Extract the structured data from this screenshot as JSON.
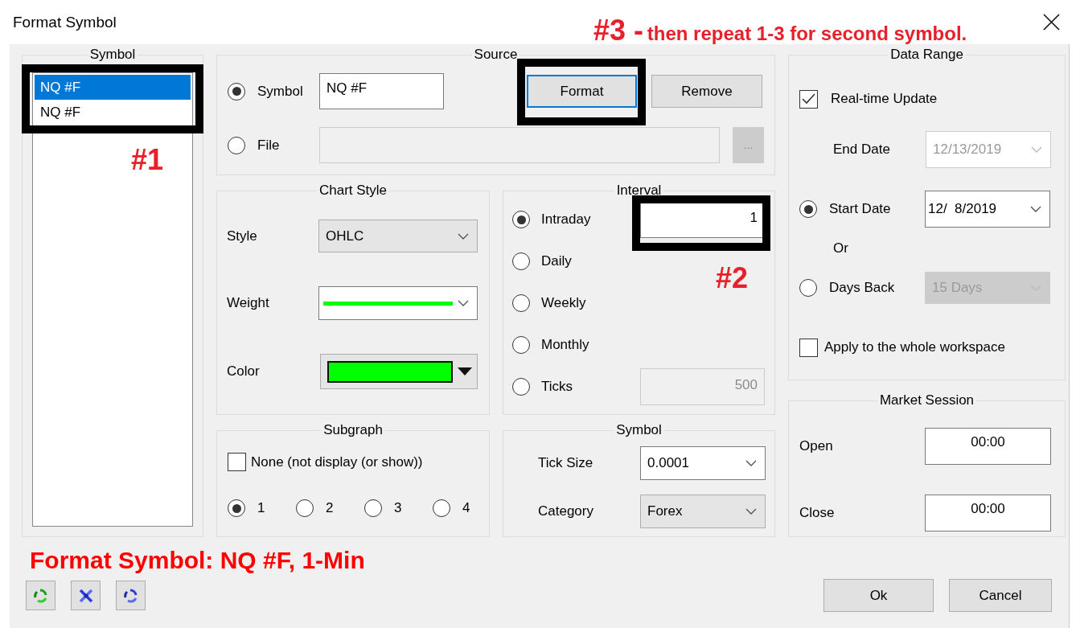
{
  "window": {
    "title": "Format Symbol"
  },
  "annotations": [
    {
      "text": "#3 -",
      "note": "then repeat 1-3 for second symbol."
    },
    {
      "text": "#1"
    },
    {
      "text": "#2"
    }
  ],
  "symbol_list": {
    "legend": "Symbol",
    "items": [
      {
        "label": "NQ #F",
        "selected": true
      },
      {
        "label": "NQ #F",
        "selected": false
      }
    ]
  },
  "source": {
    "legend": "Source",
    "options": [
      {
        "label": "Symbol",
        "selected": true,
        "value": "NQ #F",
        "disabled": false
      },
      {
        "label": "File",
        "selected": false,
        "disabled": true
      }
    ],
    "browse": "...",
    "buttons": [
      {
        "label": "Format",
        "focused": true
      },
      {
        "label": "Remove",
        "focused": false
      }
    ]
  },
  "chart_style": {
    "legend": "Chart Style",
    "style": {
      "label": "Style",
      "value": "OHLC"
    },
    "weight": {
      "label": "Weight",
      "color": "#00ff00"
    },
    "color": {
      "label": "Color",
      "color": "#00ff00"
    }
  },
  "interval": {
    "legend": "Interval",
    "options": [
      {
        "label": "Intraday",
        "selected": true,
        "value": "1",
        "disabled": false
      },
      {
        "label": "Daily",
        "selected": false
      },
      {
        "label": "Weekly",
        "selected": false
      },
      {
        "label": "Monthly",
        "selected": false
      },
      {
        "label": "Ticks",
        "selected": false,
        "value": "500",
        "disabled": true
      }
    ]
  },
  "subgraph": {
    "legend": "Subgraph",
    "none": {
      "label": "None (not display (or show))",
      "checked": false
    },
    "options": [
      {
        "label": "1",
        "selected": true
      },
      {
        "label": "2",
        "selected": false
      },
      {
        "label": "3",
        "selected": false
      },
      {
        "label": "4",
        "selected": false
      }
    ]
  },
  "symbol_info": {
    "legend": "Symbol",
    "tick_size": {
      "label": "Tick Size",
      "value": "0.0001"
    },
    "category": {
      "label": "Category",
      "value": "Forex"
    }
  },
  "data_range": {
    "legend": "Data Range",
    "realtime": {
      "label": "Real-time Update",
      "checked": true
    },
    "end_date": {
      "label": "End Date",
      "value": "12/13/2019",
      "disabled": true
    },
    "start_date": {
      "label": "Start Date",
      "selected": true,
      "value": "12/  8/2019",
      "disabled": false
    },
    "or": "Or",
    "days_back": {
      "label": "Days Back",
      "selected": false,
      "value": "15 Days",
      "disabled": true
    },
    "apply": {
      "label": "Apply to the whole workspace",
      "checked": false
    }
  },
  "market_session": {
    "legend": "Market Session",
    "open": {
      "label": "Open",
      "value": "00:00"
    },
    "close": {
      "label": "Close",
      "value": "00:00"
    }
  },
  "footer": {
    "caption": "Format Symbol: NQ #F, 1-Min",
    "buttons": [
      "Ok",
      "Cancel"
    ]
  }
}
